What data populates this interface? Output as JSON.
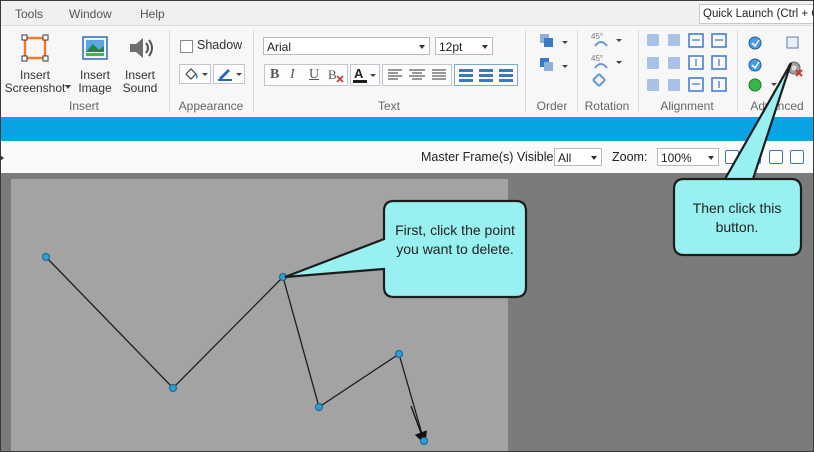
{
  "menu": {
    "tools": "Tools",
    "window": "Window",
    "help": "Help"
  },
  "quick_launch": {
    "placeholder": "Quick Launch (Ctrl + Q)"
  },
  "ribbon": {
    "insert_group": {
      "screenshot": "Insert\nScreenshot",
      "image": "Insert\nImage",
      "sound": "Insert\nSound",
      "label": "Insert"
    },
    "appearance_group": {
      "shadow": "Shadow",
      "label": "Appearance"
    },
    "text_group": {
      "font": "Arial",
      "size": "12pt",
      "bold": "B",
      "italic": "I",
      "underline": "U",
      "label": "Text"
    },
    "order_label": "Order",
    "rotation_label": "Rotation",
    "rotation_angle": "45°",
    "alignment_label": "Alignment",
    "advanced_label": "Advanced"
  },
  "subbar": {
    "master_frames_label": "Master Frame(s) Visible",
    "master_frames_value": "All",
    "zoom_label": "Zoom:",
    "zoom_value": "100%"
  },
  "callouts": {
    "first": "First, click the point you want to delete.",
    "second": "Then click this button."
  },
  "colors": {
    "accent_bar": "#0aa3e3",
    "callout_fill": "#99f0f0",
    "canvas_bg": "#7b7b7b",
    "slide_bg": "#a3a3a3",
    "point": "#2a9fd8"
  }
}
